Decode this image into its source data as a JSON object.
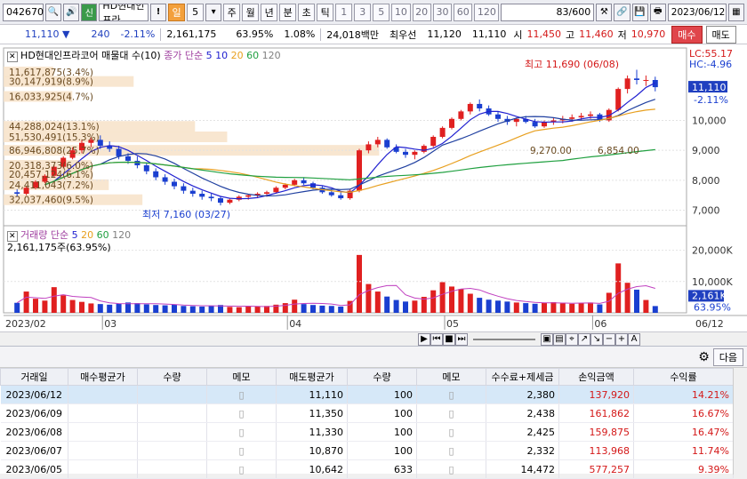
{
  "toolbar": {
    "code": "042670",
    "name": "HD현대인프라",
    "period_active": "일",
    "period_num": "5",
    "periods": [
      "주",
      "월",
      "년",
      "분",
      "초",
      "틱"
    ],
    "ticks": [
      "1",
      "3",
      "5",
      "10",
      "20",
      "30",
      "60",
      "120"
    ],
    "count": "83/600",
    "date": "2023/06/12",
    "icon_names": [
      "search-icon",
      "speaker-icon",
      "tag-icon",
      "alert-icon",
      "chart-tool-icon",
      "link-icon",
      "save-icon",
      "print-icon",
      "calendar-icon"
    ]
  },
  "quote": {
    "price": "11,110",
    "arrow": "▼",
    "change": "240",
    "change_pct": "-2.11%",
    "volume": "2,161,175",
    "vol_ratio": "63.95%",
    "turnover": "1.08%",
    "amount": "24,018백만",
    "best_ask_label": "최우선",
    "best_ask": "11,120",
    "best_bid": "11,110",
    "open_label": "시",
    "open": "11,450",
    "high_label": "고",
    "high": "11,460",
    "low_label": "저",
    "low": "10,970",
    "buy_label": "매수",
    "sell_label": "매도"
  },
  "chart": {
    "price_legend": "HD현대인프라코어 매물대 수(10)",
    "ma_legend_prefix": "종가 단순",
    "ma_periods": [
      "5",
      "10",
      "20",
      "60",
      "120"
    ],
    "ma_colors": [
      "#2020d0",
      "#2020d0",
      "#e8a020",
      "#20a040",
      "#808080"
    ],
    "lc_label": "LC:55.17",
    "hc_label": "HC:-4.96",
    "cur_price": "11,110",
    "cur_change": "-2.11%",
    "high_note": "최고 11,690 (06/08)",
    "low_note": "최저 7,160 (03/27)",
    "price_ticks": [
      "10,000",
      "9,000",
      "8,000",
      "7,000"
    ],
    "vol_legend": "거래량 단순",
    "vol_periods": [
      "5",
      "20",
      "60",
      "120"
    ],
    "vol_now": "2,161,175주(63.95%)",
    "vol_ticks": [
      "20,000K",
      "10,000K"
    ],
    "vol_cur": "2,161K",
    "vol_pct": "63.95%",
    "dates": [
      "2023/02",
      "03",
      "04",
      "05",
      "06",
      "06/12"
    ],
    "volume_profile": [
      {
        "price": 11617,
        "label": "11,617,875(3.4%)"
      },
      {
        "price": 11300,
        "label": "30,147,919(8.9%)"
      },
      {
        "price": 10800,
        "label": "16,033,925(4.7%)"
      },
      {
        "price": 9800,
        "label": "44,288,024(13.1%)"
      },
      {
        "price": 9450,
        "label": "51,530,491(15.3%)"
      },
      {
        "price": 9000,
        "label": "86,946,808(25.7%)"
      },
      {
        "price": 8500,
        "label": "20,318,373(6.0%)"
      },
      {
        "price": 8200,
        "label": "20,457,124(6.1%)"
      },
      {
        "price": 7850,
        "label": "24,411,043(7.2%)"
      },
      {
        "price": 7350,
        "label": "32,037,460(9.5%)"
      }
    ],
    "profile_note_a": "9,270.00",
    "profile_note_b": "6,854.00"
  },
  "nav": {
    "icons": [
      "prev-icon",
      "play-icon",
      "stop-icon",
      "next-icon",
      "zoom-slider",
      "fit-icon",
      "toggle-icon",
      "crosshair-icon",
      "minus-icon",
      "plus-icon"
    ],
    "zoom_minus": "−",
    "zoom_plus": "+",
    "font_label": "A"
  },
  "grid": {
    "next_label": "다음",
    "headers": [
      "거래일",
      "매수평균가",
      "수량",
      "메모",
      "매도평균가",
      "수량",
      "메모",
      "수수료+제세금",
      "손익금액",
      "수익률"
    ],
    "rows": [
      {
        "date": "2023/06/12",
        "buy_avg": "",
        "buy_qty": "",
        "sell_avg": "11,110",
        "sell_qty": "100",
        "fee": "2,380",
        "pnl": "137,920",
        "ret": "14.21%"
      },
      {
        "date": "2023/06/09",
        "buy_avg": "",
        "buy_qty": "",
        "sell_avg": "11,350",
        "sell_qty": "100",
        "fee": "2,438",
        "pnl": "161,862",
        "ret": "16.67%"
      },
      {
        "date": "2023/06/08",
        "buy_avg": "",
        "buy_qty": "",
        "sell_avg": "11,330",
        "sell_qty": "100",
        "fee": "2,425",
        "pnl": "159,875",
        "ret": "16.47%"
      },
      {
        "date": "2023/06/07",
        "buy_avg": "",
        "buy_qty": "",
        "sell_avg": "10,870",
        "sell_qty": "100",
        "fee": "2,332",
        "pnl": "113,968",
        "ret": "11.74%"
      },
      {
        "date": "2023/06/05",
        "buy_avg": "",
        "buy_qty": "",
        "sell_avg": "10,642",
        "sell_qty": "633",
        "fee": "14,472",
        "pnl": "577,257",
        "ret": "9.39%"
      }
    ]
  },
  "chart_data": {
    "type": "candlestick",
    "ylim": [
      6600,
      12300
    ],
    "vol_ylim": [
      0,
      25000
    ],
    "candles": [
      [
        7600,
        7700,
        7450,
        7550
      ],
      [
        7550,
        7800,
        7500,
        7750
      ],
      [
        7750,
        8000,
        7700,
        7950
      ],
      [
        7950,
        8200,
        7900,
        8150
      ],
      [
        8150,
        8500,
        8100,
        8450
      ],
      [
        8450,
        8800,
        8400,
        8750
      ],
      [
        8750,
        9100,
        8700,
        9000
      ],
      [
        9000,
        9350,
        8900,
        9250
      ],
      [
        9250,
        9450,
        9100,
        9350
      ],
      [
        9350,
        9500,
        9050,
        9150
      ],
      [
        9150,
        9300,
        8950,
        9050
      ],
      [
        9050,
        9150,
        8700,
        8800
      ],
      [
        8800,
        8900,
        8550,
        8650
      ],
      [
        8650,
        8800,
        8400,
        8500
      ],
      [
        8500,
        8600,
        8200,
        8300
      ],
      [
        8300,
        8400,
        8000,
        8100
      ],
      [
        8100,
        8200,
        7850,
        7950
      ],
      [
        7950,
        8050,
        7700,
        7800
      ],
      [
        7800,
        7900,
        7550,
        7650
      ],
      [
        7650,
        7750,
        7450,
        7550
      ],
      [
        7550,
        7650,
        7350,
        7450
      ],
      [
        7450,
        7550,
        7300,
        7400
      ],
      [
        7400,
        7450,
        7160,
        7250
      ],
      [
        7250,
        7400,
        7200,
        7350
      ],
      [
        7350,
        7500,
        7300,
        7450
      ],
      [
        7450,
        7550,
        7350,
        7500
      ],
      [
        7500,
        7600,
        7400,
        7550
      ],
      [
        7550,
        7650,
        7450,
        7600
      ],
      [
        7600,
        7800,
        7550,
        7750
      ],
      [
        7750,
        7900,
        7700,
        7850
      ],
      [
        7850,
        8050,
        7800,
        8000
      ],
      [
        8000,
        8100,
        7850,
        7900
      ],
      [
        7900,
        7950,
        7700,
        7750
      ],
      [
        7750,
        7800,
        7550,
        7600
      ],
      [
        7600,
        7700,
        7450,
        7500
      ],
      [
        7500,
        7600,
        7350,
        7400
      ],
      [
        7400,
        7700,
        7350,
        7650
      ],
      [
        7650,
        9050,
        7600,
        9000
      ],
      [
        9000,
        9300,
        8900,
        9200
      ],
      [
        9200,
        9450,
        9100,
        9350
      ],
      [
        9350,
        9400,
        9050,
        9100
      ],
      [
        9100,
        9200,
        8900,
        8950
      ],
      [
        8950,
        9050,
        8750,
        8850
      ],
      [
        8850,
        9000,
        8700,
        8950
      ],
      [
        8950,
        9200,
        8900,
        9150
      ],
      [
        9150,
        9500,
        9100,
        9450
      ],
      [
        9450,
        9800,
        9400,
        9750
      ],
      [
        9750,
        10100,
        9700,
        10050
      ],
      [
        10050,
        10350,
        10000,
        10300
      ],
      [
        10300,
        10600,
        10200,
        10550
      ],
      [
        10550,
        10700,
        10300,
        10400
      ],
      [
        10400,
        10500,
        10150,
        10200
      ],
      [
        10200,
        10300,
        9950,
        10050
      ],
      [
        10050,
        10150,
        9850,
        9950
      ],
      [
        9950,
        10100,
        9800,
        10050
      ],
      [
        10050,
        10150,
        9900,
        9950
      ],
      [
        9950,
        10050,
        9750,
        9800
      ],
      [
        9800,
        10000,
        9750,
        9950
      ],
      [
        9950,
        10100,
        9850,
        10000
      ],
      [
        10000,
        10150,
        9900,
        10050
      ],
      [
        10050,
        10200,
        9950,
        10100
      ],
      [
        10100,
        10250,
        10000,
        10150
      ],
      [
        10150,
        10300,
        10050,
        10200
      ],
      [
        10200,
        10250,
        9950,
        10000
      ],
      [
        10000,
        10400,
        9950,
        10350
      ],
      [
        10350,
        11100,
        10300,
        11050
      ],
      [
        11050,
        11500,
        10900,
        11400
      ],
      [
        11400,
        11690,
        11200,
        11350
      ],
      [
        11350,
        11500,
        11150,
        11350
      ],
      [
        11350,
        11460,
        10970,
        11110
      ]
    ],
    "volumes": [
      3200,
      6800,
      4500,
      3900,
      8200,
      5600,
      4100,
      3500,
      3000,
      2800,
      2600,
      2900,
      3300,
      3100,
      2700,
      2500,
      2400,
      2600,
      2200,
      2100,
      2000,
      2300,
      2500,
      1900,
      1800,
      2100,
      2000,
      2200,
      2600,
      3100,
      4200,
      2800,
      2500,
      2300,
      2200,
      2000,
      3800,
      18500,
      9200,
      6800,
      5200,
      4100,
      3600,
      3900,
      5100,
      7200,
      9800,
      8400,
      7600,
      6100,
      4800,
      4200,
      3900,
      3600,
      3300,
      3100,
      2900,
      3200,
      3400,
      3000,
      2900,
      3100,
      3300,
      2700,
      6400,
      15800,
      9600,
      7400,
      4100,
      2161
    ]
  }
}
